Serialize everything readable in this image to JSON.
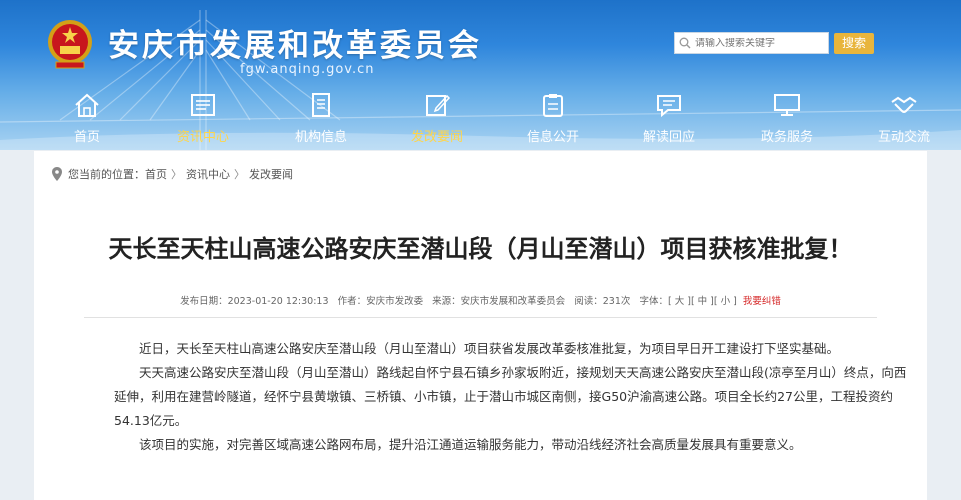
{
  "site": {
    "title": "安庆市发展和改革委员会",
    "url": "fgw.anqing.gov.cn"
  },
  "search": {
    "placeholder": "请输入搜索关键字",
    "button": "搜索"
  },
  "nav": [
    {
      "label": "首页",
      "icon": "home-icon"
    },
    {
      "label": "资讯中心",
      "icon": "news-icon",
      "active": true
    },
    {
      "label": "机构信息",
      "icon": "document-icon"
    },
    {
      "label": "发改要闻",
      "icon": "edit-icon",
      "active": true
    },
    {
      "label": "信息公开",
      "icon": "clipboard-icon"
    },
    {
      "label": "解读回应",
      "icon": "message-icon"
    },
    {
      "label": "政务服务",
      "icon": "monitor-icon"
    },
    {
      "label": "互动交流",
      "icon": "handshake-icon"
    }
  ],
  "breadcrumb": {
    "prefix": "您当前的位置：",
    "items": [
      "首页",
      "资讯中心",
      "发改要闻"
    ],
    "separator": "〉"
  },
  "article": {
    "title": "天长至天柱山高速公路安庆至潜山段（月山至潜山）项目获核准批复！",
    "meta": {
      "published_label": "发布日期：",
      "published": "2023-01-20 12:30:13",
      "author_label": "作者：",
      "author": "安庆市发改委",
      "source_label": "来源：",
      "source": "安庆市发展和改革委员会",
      "views_label": "阅读：",
      "views": "231次",
      "font_label": "字体：",
      "font_large": "[ 大 ]",
      "font_medium": "[ 中 ]",
      "font_small": "[ 小 ]",
      "error_link": "我要纠错"
    },
    "paragraphs": [
      "近日，天长至天柱山高速公路安庆至潜山段（月山至潜山）项目获省发展改革委核准批复，为项目早日开工建设打下坚实基础。",
      "天天高速公路安庆至潜山段（月山至潜山）路线起自怀宁县石镇乡孙家坂附近，接规划天天高速公路安庆至潜山段(凉亭至月山）终点，向西延伸，利用在建营岭隧道，经怀宁县黄墩镇、三桥镇、小市镇，止于潜山市城区南侧，接G50沪渝高速公路。项目全长约27公里，工程投资约54.13亿元。",
      "该项目的实施，对完善区域高速公路网布局，提升沿江通道运输服务能力，带动沿线经济社会高质量发展具有重要意义。"
    ]
  },
  "colors": {
    "header_blue": "#2f86dc",
    "active_nav": "#ffd54a",
    "search_button": "#e8b53c",
    "error_link": "#d62b2b"
  }
}
